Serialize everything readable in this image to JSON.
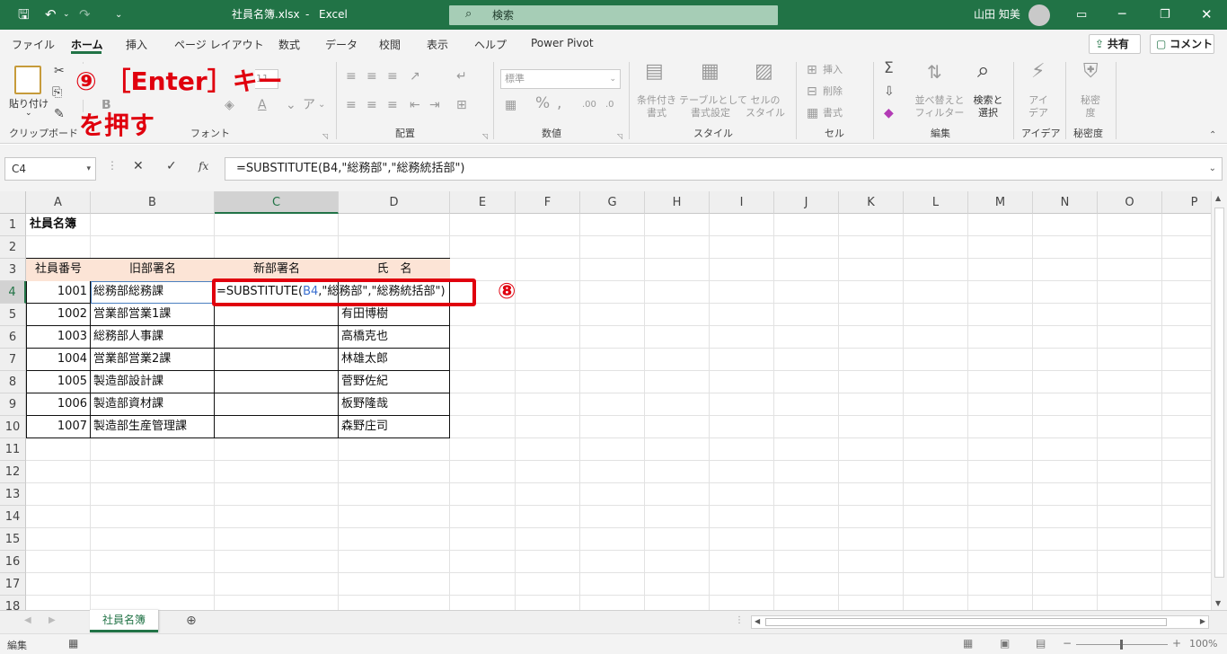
{
  "titlebar": {
    "filename": "社員名簿.xlsx",
    "sep": "-",
    "app": "Excel",
    "search_placeholder": "検索",
    "user": "山田 知美"
  },
  "menu": [
    "ファイル",
    "ホーム",
    "挿入",
    "ページ レイアウト",
    "数式",
    "データ",
    "校閲",
    "表示",
    "ヘルプ",
    "Power Pivot"
  ],
  "share_label": "共有",
  "comment_label": "コメント",
  "ribbon": {
    "paste_label": "貼り付け",
    "clipboard_label": "クリップボード",
    "font_label": "フォント",
    "font_size": "11",
    "align_label": "配置",
    "number_format": "標準",
    "number_label": "数値",
    "cond_format": "条件付き\n書式",
    "table_format": "テーブルとして\n書式設定",
    "cell_style": "セルの\nスタイル",
    "style_label": "スタイル",
    "insert": "挿入",
    "delete": "削除",
    "format": "書式",
    "cells_label": "セル",
    "sort_filter": "並べ替えと\nフィルター",
    "find_select": "検索と\n選択",
    "edit_label": "編集",
    "idea": "アイ\nデア",
    "idea_label": "アイデア",
    "sensitivity": "秘密\n度",
    "sensitivity_label": "秘密度"
  },
  "formula_bar": {
    "name_box": "C4",
    "fx": "fx",
    "formula": "=SUBSTITUTE(B4,\"総務部\",\"総務統括部\")"
  },
  "columns": [
    "A",
    "B",
    "C",
    "D",
    "E",
    "F",
    "G",
    "H",
    "I",
    "J",
    "K",
    "L",
    "M",
    "N",
    "O",
    "P"
  ],
  "rows": [
    "1",
    "2",
    "3",
    "4",
    "5",
    "6",
    "7",
    "8",
    "9",
    "10",
    "11",
    "12",
    "13",
    "14",
    "15",
    "16",
    "17",
    "18"
  ],
  "sheet": {
    "title": "社員名簿",
    "headers": [
      "社員番号",
      "旧部署名",
      "新部署名",
      "氏　名"
    ],
    "data": [
      {
        "id": "1001",
        "dept": "総務部総務課",
        "name": ""
      },
      {
        "id": "1002",
        "dept": "営業部営業1課",
        "name": "有田博樹"
      },
      {
        "id": "1003",
        "dept": "総務部人事課",
        "name": "高橋克也"
      },
      {
        "id": "1004",
        "dept": "営業部営業2課",
        "name": "林雄太郎"
      },
      {
        "id": "1005",
        "dept": "製造部設計課",
        "name": "菅野佐紀"
      },
      {
        "id": "1006",
        "dept": "製造部資材課",
        "name": "板野隆哉"
      },
      {
        "id": "1007",
        "dept": "製造部生産管理課",
        "name": "森野庄司"
      }
    ],
    "edit_prefix": "=SUBSTITUTE(",
    "edit_ref": "B4",
    "edit_suffix": ",\"総務部\",\"総務統括部\")"
  },
  "annotations": {
    "step8": "⑧",
    "step9_line1": "⑨ ［Enter］キー",
    "step9_line2": "を押す"
  },
  "sheet_tab": "社員名簿",
  "status": {
    "mode": "編集",
    "zoom": "100%"
  },
  "colors": {
    "excel_green": "#217346",
    "header_fill": "#fce4d6",
    "annotation_red": "#e0000e"
  }
}
